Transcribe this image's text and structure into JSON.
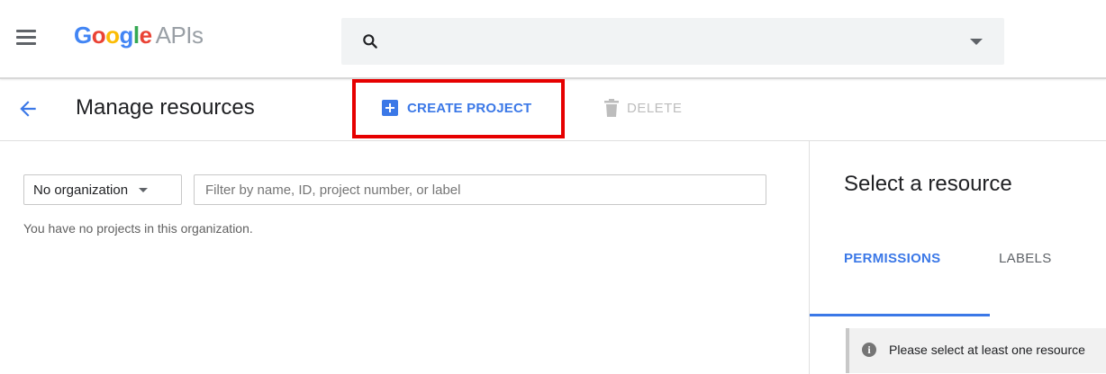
{
  "header": {
    "menu_icon": "hamburger-menu-icon",
    "logo": {
      "g1": "G",
      "o1": "o",
      "o2": "o",
      "g2": "g",
      "l": "l",
      "e": "e",
      "product": "APIs"
    },
    "search": {
      "value": "",
      "placeholder": "",
      "icon": "search-icon",
      "dropdown_icon": "caret-down-icon"
    }
  },
  "actionbar": {
    "back_icon": "arrow-back-icon",
    "title": "Manage resources",
    "create_label": "CREATE PROJECT",
    "delete_label": "DELETE",
    "highlight_color": "#e60000",
    "accent_color": "#3b78e7"
  },
  "main": {
    "org_select_value": "No organization",
    "filter_placeholder": "Filter by name, ID, project number, or label",
    "empty_message": "You have no projects in this organization."
  },
  "right_panel": {
    "title": "Select a resource",
    "tabs": [
      {
        "label": "PERMISSIONS",
        "active": true
      },
      {
        "label": "LABELS",
        "active": false
      }
    ],
    "info_icon_glyph": "i",
    "info_message": "Please select at least one resource"
  }
}
